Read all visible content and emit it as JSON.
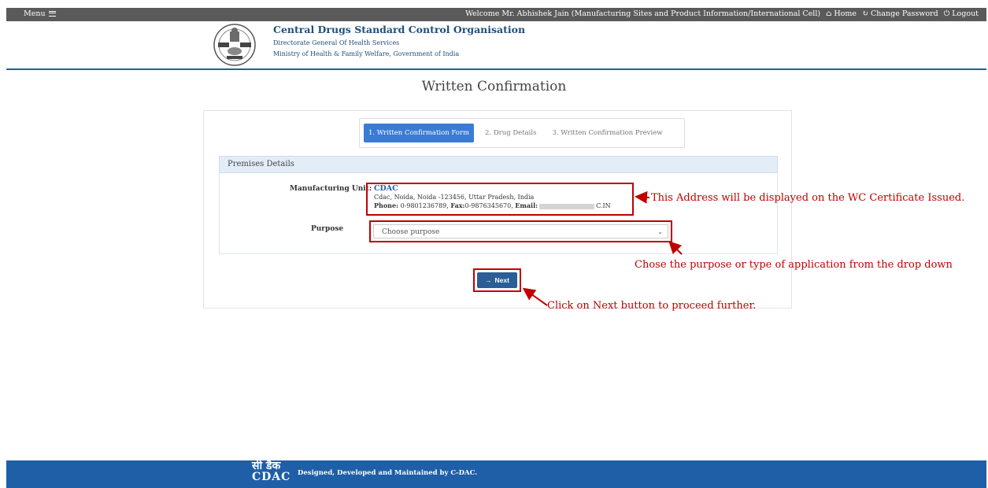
{
  "topbar": {
    "menu_label": "Menu",
    "welcome": "Welcome Mr. Abhishek Jain  (Manufacturing Sites and Product Information/International Cell)",
    "home": "Home",
    "change_password": "Change Password",
    "logout": "Logout"
  },
  "header": {
    "org_name": "Central Drugs Standard Control Organisation",
    "line1": "Directorate General Of Health Services",
    "line2": "Ministry of Health & Family Welfare, Government of India"
  },
  "page": {
    "title": "Written Confirmation"
  },
  "steps": [
    {
      "label": "1. Written Confirmation Form",
      "active": true
    },
    {
      "label": "2. Drug Details",
      "active": false
    },
    {
      "label": "3. Written Confirmation Preview",
      "active": false
    }
  ],
  "premises": {
    "heading": "Premises Details",
    "manufacturing_unit_label": "Manufacturing Unit:",
    "unit_name": "CDAC",
    "address": "Cdac, Noida, Noida -123456, Uttar Pradesh, India",
    "phone_label": "Phone:",
    "phone": "0-9801236789,",
    "fax_label": "Fax:",
    "fax": "0-9876345670,",
    "email_label": "Email:",
    "email_tail": "C.IN",
    "purpose_label": "Purpose",
    "purpose_placeholder": "Choose purpose"
  },
  "next_button": "Next",
  "annotations": {
    "address": "This Address will be displayed on the WC Certificate Issued.",
    "purpose": "Chose the purpose or type of application from the drop down",
    "next": "Click on Next button to proceed further."
  },
  "footer": {
    "logo_hindi": "सी डैक",
    "logo_en": "CDAC",
    "text": "Designed, Developed and Maintained by C-DAC."
  },
  "colors": {
    "accent": "#1f5f9e",
    "annotation": "#c00000",
    "topbar": "#5a5a5a",
    "footer": "#1e5fa8"
  }
}
